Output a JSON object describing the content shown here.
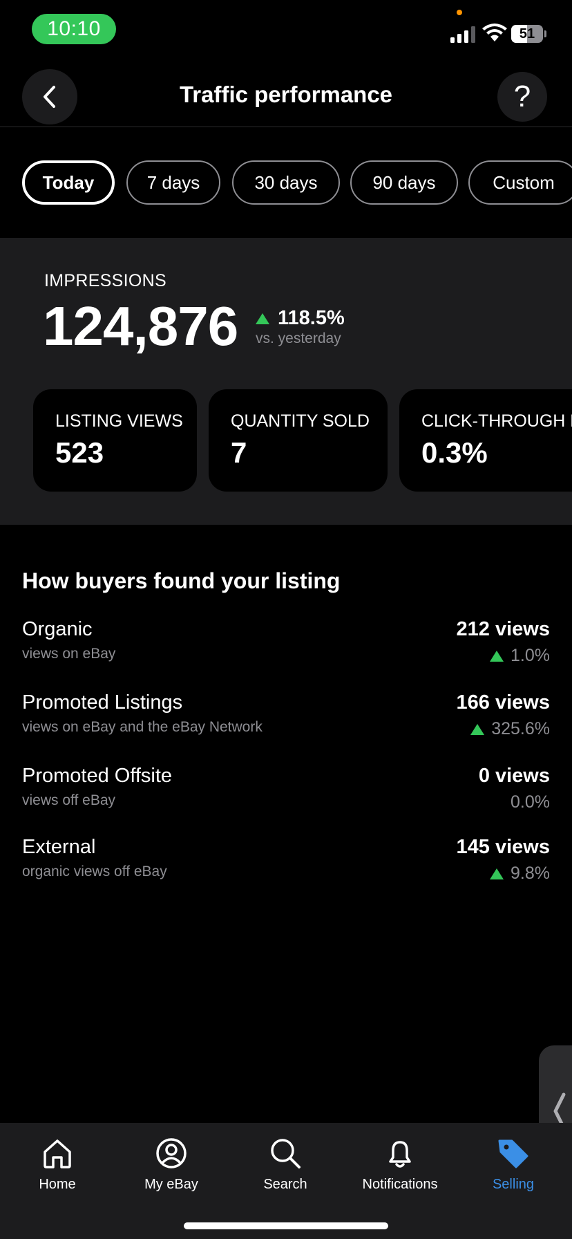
{
  "status_bar": {
    "time": "10:10",
    "battery": "51",
    "battery_level": 0.51
  },
  "header": {
    "title": "Traffic performance",
    "back_icon": "chevron-left-icon",
    "help_label": "?"
  },
  "date_range": {
    "options": [
      "Today",
      "7 days",
      "30 days",
      "90 days",
      "Custom"
    ],
    "selected": "Today"
  },
  "impressions": {
    "label": "IMPRESSIONS",
    "value": "124,876",
    "change": "118.5%",
    "comparison": "vs. yesterday"
  },
  "metric_cards": [
    {
      "label": "LISTING VIEWS",
      "value": "523"
    },
    {
      "label": "QUANTITY SOLD",
      "value": "7"
    },
    {
      "label": "CLICK-THROUGH RATE",
      "value": "0.3%"
    }
  ],
  "sources": {
    "title": "How buyers found your listing",
    "items": [
      {
        "name": "Organic",
        "description": "views on eBay",
        "views": "212 views",
        "change": "1.0%",
        "trend": "up"
      },
      {
        "name": "Promoted Listings",
        "description": "views on eBay and the eBay Network",
        "views": "166 views",
        "change": "325.6%",
        "trend": "up"
      },
      {
        "name": "Promoted Offsite",
        "description": "views off eBay",
        "views": "0 views",
        "change": "0.0%",
        "trend": "none"
      },
      {
        "name": "External",
        "description": "organic views off eBay",
        "views": "145 views",
        "change": "9.8%",
        "trend": "up"
      }
    ]
  },
  "tab_bar": {
    "tabs": [
      {
        "label": "Home",
        "icon": "home-icon"
      },
      {
        "label": "My eBay",
        "icon": "profile-icon"
      },
      {
        "label": "Search",
        "icon": "search-icon"
      },
      {
        "label": "Notifications",
        "icon": "bell-icon"
      },
      {
        "label": "Selling",
        "icon": "tag-icon"
      }
    ],
    "active": "Selling"
  },
  "colors": {
    "accent": "#3b8fe6",
    "positive": "#34c759",
    "background": "#000000",
    "panel": "#1c1c1e"
  }
}
